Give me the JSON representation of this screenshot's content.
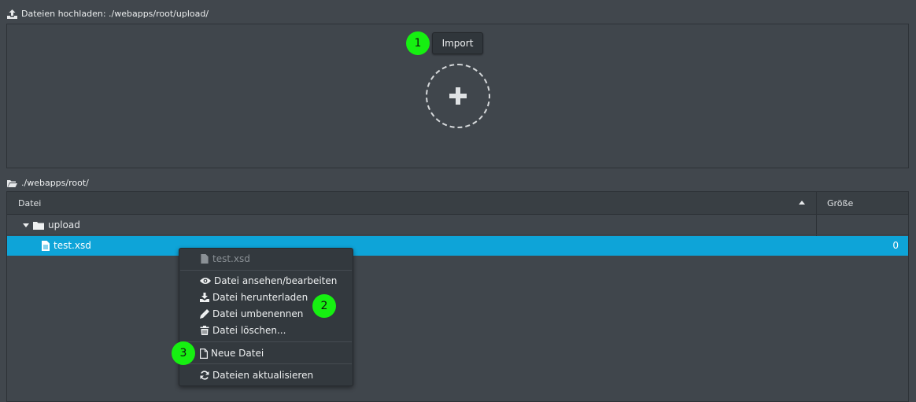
{
  "upload_section": {
    "title": "Dateien hochladen: ./webapps/root/upload/",
    "import_label": "Import"
  },
  "tree_section": {
    "title": "./webapps/root/",
    "columns": {
      "file": "Datei",
      "size": "Größe"
    },
    "rows": [
      {
        "name": "upload",
        "type": "folder",
        "size": "",
        "expanded": true
      },
      {
        "name": "test.xsd",
        "type": "file",
        "size": "0",
        "selected": true
      }
    ]
  },
  "context_menu": {
    "header": "test.xsd",
    "items": [
      {
        "label": "Datei ansehen/bearbeiten",
        "icon": "eye-icon"
      },
      {
        "label": "Datei herunterladen",
        "icon": "download-icon"
      },
      {
        "label": "Datei umbenennen",
        "icon": "pencil-icon"
      },
      {
        "label": "Datei löschen...",
        "icon": "trash-icon"
      },
      {
        "label": "Neue Datei",
        "icon": "file-icon"
      },
      {
        "label": "Dateien aktualisieren",
        "icon": "refresh-icon"
      }
    ]
  },
  "markers": [
    "1",
    "2",
    "3"
  ],
  "colors": {
    "background": "#41474d",
    "selection": "#0ea4d8",
    "marker": "#16f011",
    "menu_background": "#33393e"
  }
}
